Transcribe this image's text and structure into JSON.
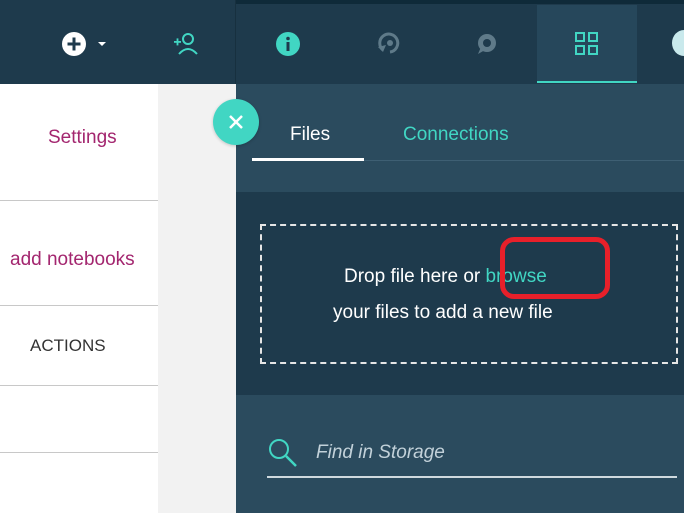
{
  "topbar": {
    "icons": [
      "add-icon",
      "chevron-down-icon",
      "add-user-icon",
      "info-icon",
      "history-icon",
      "chat-icon",
      "data-icon"
    ]
  },
  "left": {
    "settings_label": "Settings",
    "add_notebooks_label": "add notebooks",
    "actions_header": "ACTIONS"
  },
  "panel": {
    "tabs": [
      {
        "label": "Files",
        "active": true
      },
      {
        "label": "Connections",
        "active": false
      }
    ],
    "drop": {
      "text_before": "Drop file here or ",
      "browse": "browse",
      "text_after": "your files to add a new file"
    },
    "search": {
      "placeholder": "Find in Storage",
      "value": ""
    }
  },
  "colors": {
    "accent": "#41d6c3",
    "dark_bg": "#1e3a4c",
    "panel_bg": "#2b4b5e",
    "link_magenta": "#a3266f",
    "highlight_red": "#e8202a"
  }
}
